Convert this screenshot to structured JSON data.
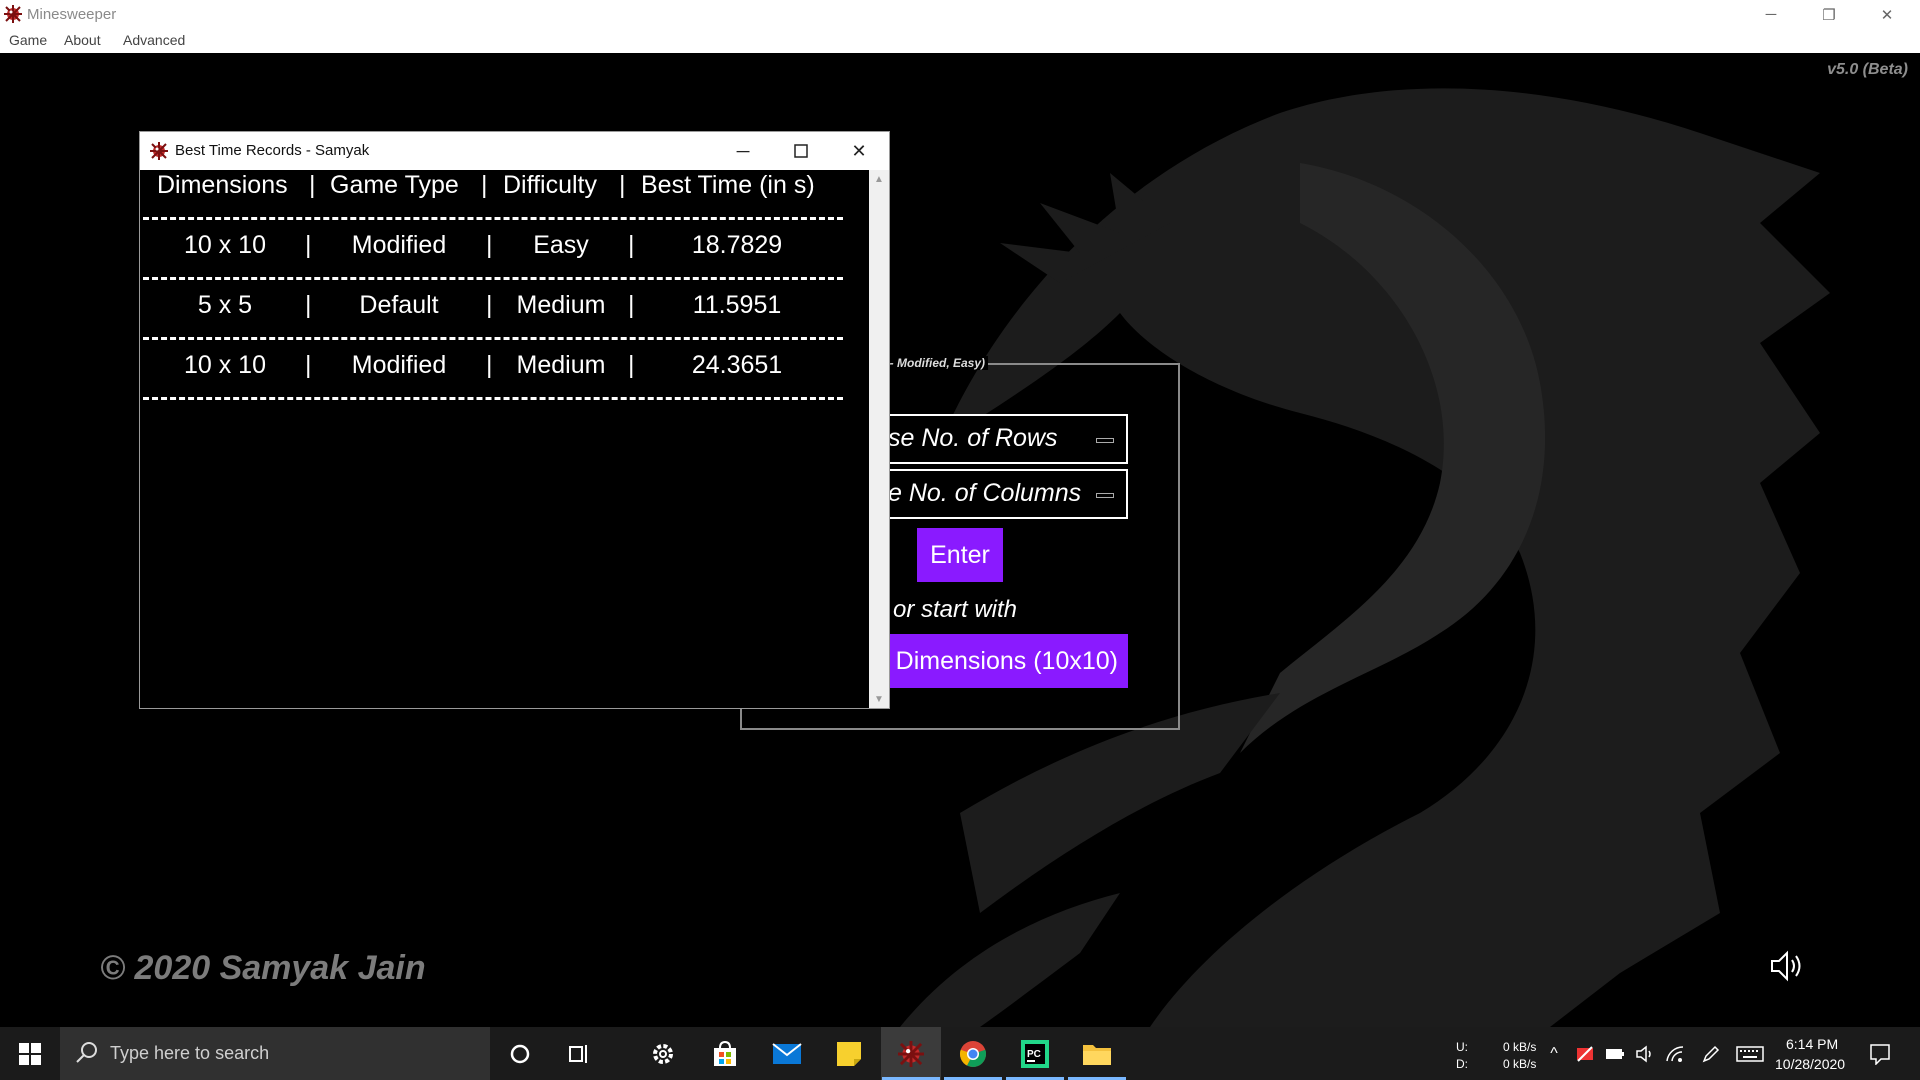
{
  "window": {
    "title": "Minesweeper",
    "controls": {
      "minimize": "─",
      "restore": "❐",
      "close": "✕"
    }
  },
  "menu": [
    "Game",
    "About",
    "Advanced"
  ],
  "game": {
    "version": "v5.0 (Beta)",
    "copyright": "© 2020 Samyak Jain",
    "form": {
      "legend": "e- Modified, Easy)",
      "rows_field": "se No. of Rows",
      "columns_field": "e No. of Columns",
      "enter_label": "Enter",
      "or_text": "or start with",
      "default_label": "Dimensions (10x10)"
    }
  },
  "dialog": {
    "title": "Best Time Records - Samyak",
    "headers": [
      "Dimensions",
      "Game Type",
      "Difficulty",
      "Best Time (in s)"
    ],
    "separator": "|",
    "rows": [
      [
        "10 x 10",
        "Modified",
        "Easy",
        "18.7829"
      ],
      [
        "5 x 5",
        "Default",
        "Medium",
        "11.5951"
      ],
      [
        "10 x 10",
        "Modified",
        "Medium",
        "24.3651"
      ]
    ]
  },
  "taskbar": {
    "search_placeholder": "Type here to search",
    "net_u_label": "U:",
    "net_d_label": "D:",
    "net_u_value": "0 kB/s",
    "net_d_value": "0 kB/s",
    "time": "6:14 PM",
    "date": "10/28/2020"
  },
  "colors": {
    "accent": "#8a1aff",
    "background": "#000000",
    "dragon": "#1c1c1c"
  },
  "icons": [
    "mine-icon",
    "speaker-icon",
    "windows-start-icon",
    "search-icon",
    "cortana-icon",
    "task-view-icon",
    "settings-icon",
    "store-icon",
    "mail-icon",
    "sticky-notes-icon",
    "chrome-icon",
    "pycharm-icon",
    "file-explorer-icon",
    "notification-icon"
  ]
}
